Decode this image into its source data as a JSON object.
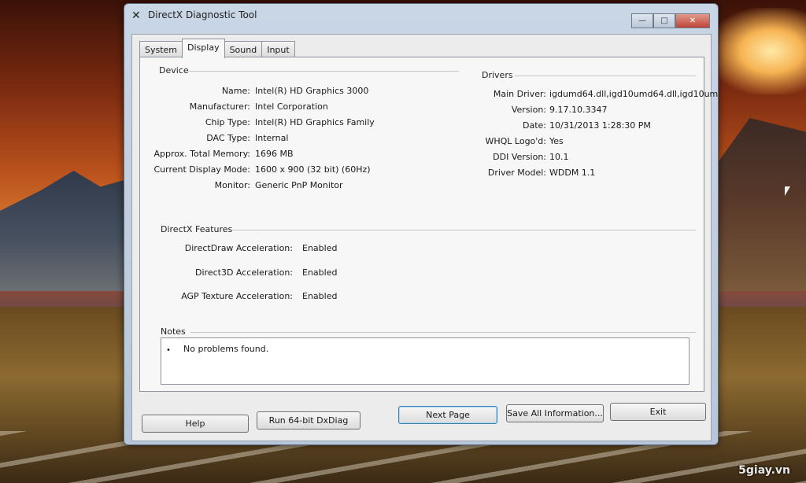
{
  "window": {
    "title": "DirectX Diagnostic Tool",
    "minimize": "—",
    "maximize": "□",
    "close": "✕"
  },
  "tabs": [
    {
      "label": "System",
      "active": false
    },
    {
      "label": "Display",
      "active": true
    },
    {
      "label": "Sound",
      "active": false
    },
    {
      "label": "Input",
      "active": false
    }
  ],
  "device": {
    "heading": "Device",
    "rows": [
      {
        "key": "Name:",
        "value": "Intel(R) HD Graphics 3000"
      },
      {
        "key": "Manufacturer:",
        "value": "Intel Corporation"
      },
      {
        "key": "Chip Type:",
        "value": "Intel(R) HD Graphics Family"
      },
      {
        "key": "DAC Type:",
        "value": "Internal"
      },
      {
        "key": "Approx. Total Memory:",
        "value": "1696 MB"
      },
      {
        "key": "Current Display Mode:",
        "value": "1600 x 900 (32 bit) (60Hz)"
      },
      {
        "key": "Monitor:",
        "value": "Generic PnP Monitor"
      }
    ]
  },
  "drivers": {
    "heading": "Drivers",
    "rows": [
      {
        "key": "Main Driver:",
        "value": "igdumd64.dll,igd10umd64.dll,igd10um"
      },
      {
        "key": "Version:",
        "value": "9.17.10.3347"
      },
      {
        "key": "Date:",
        "value": "10/31/2013 1:28:30 PM"
      },
      {
        "key": "WHQL Logo'd:",
        "value": "Yes"
      },
      {
        "key": "DDI Version:",
        "value": "10.1"
      },
      {
        "key": "Driver Model:",
        "value": "WDDM 1.1"
      }
    ]
  },
  "features": {
    "heading": "DirectX Features",
    "rows": [
      {
        "key": "DirectDraw Acceleration:",
        "value": "Enabled"
      },
      {
        "key": "Direct3D Acceleration:",
        "value": "Enabled"
      },
      {
        "key": "AGP Texture Acceleration:",
        "value": "Enabled"
      }
    ]
  },
  "notes": {
    "heading": "Notes",
    "bullet": "•",
    "items": [
      "No problems found."
    ]
  },
  "buttons": {
    "help": "Help",
    "run64": "Run 64-bit DxDiag",
    "next": "Next Page",
    "save": "Save All Information...",
    "exit": "Exit"
  },
  "watermark": "5giay.vn"
}
